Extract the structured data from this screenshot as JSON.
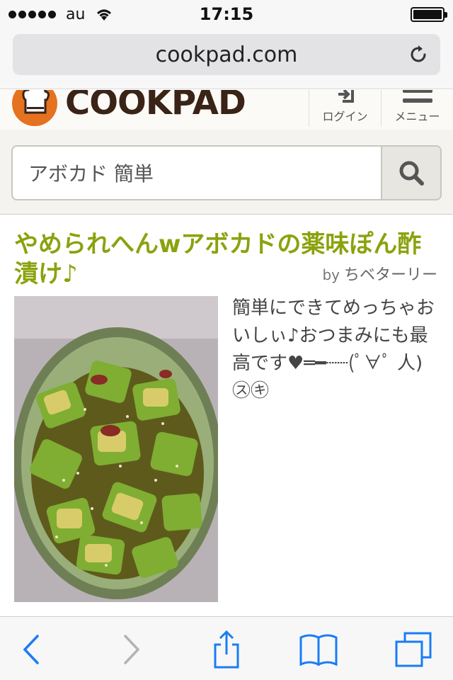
{
  "status_bar": {
    "carrier": "au",
    "time": "17:15",
    "battery_level": 1.0
  },
  "browser": {
    "url": "cookpad.com"
  },
  "site_header": {
    "logo_text": "COOKPAD",
    "login_label": "ログイン",
    "menu_label": "メニュー"
  },
  "search": {
    "query": "アボカド 簡単"
  },
  "recipe": {
    "title": "やめられへんwアボカドの薬味ぽん酢漬け♪",
    "by_label": "by",
    "author": "ちベターリー",
    "description": "簡単にできてめっちゃおいしぃ♪おつまみにも最高です♥═━┈┈(ﾟ∀ﾟ 人)㋜㋖"
  },
  "colors": {
    "brand_green": "#8ba20d",
    "brand_orange": "#e5721f",
    "ios_blue": "#1a7cf5"
  }
}
